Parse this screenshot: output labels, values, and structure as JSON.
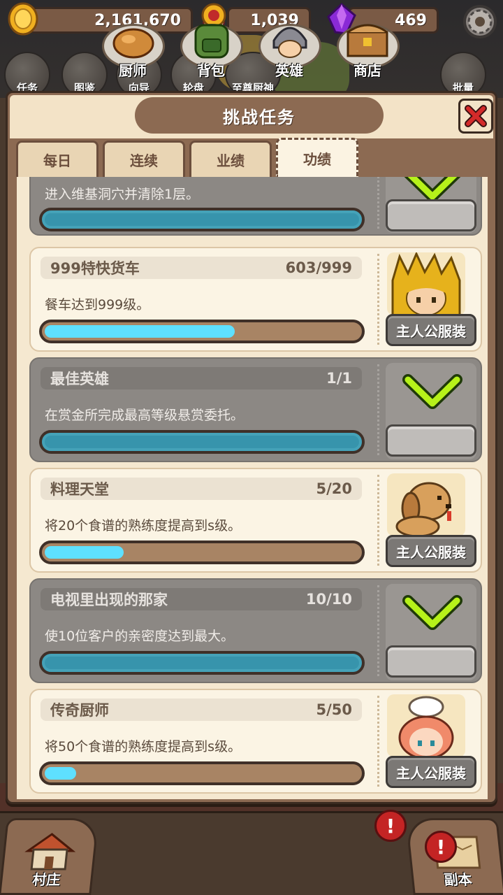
{
  "currency": {
    "gold": "2,161,670",
    "medal": "1,039",
    "gem": "469"
  },
  "shortcuts": [
    "任务",
    "图鉴",
    "向导",
    "轮盘",
    "至尊厨神",
    "",
    "",
    "",
    "批量"
  ],
  "modal": {
    "title": "挑战任务",
    "tabs": [
      "每日",
      "连续",
      "业绩",
      "功绩"
    ],
    "active_tab": "功绩"
  },
  "missions": [
    {
      "title": "",
      "progress": "",
      "desc": "进入维基洞穴并清除1层。",
      "state": "completed",
      "fill": 1.0
    },
    {
      "title": "999特快货车",
      "progress": "603/999",
      "desc": "餐车达到999级。",
      "state": "in_progress",
      "fill": 0.604,
      "reward": "主人公服装"
    },
    {
      "title": "最佳英雄",
      "progress": "1/1",
      "desc": "在赏金所完成最高等级悬赏委托。",
      "state": "completed",
      "fill": 1.0
    },
    {
      "title": "料理天堂",
      "progress": "5/20",
      "desc": "将20个食谱的熟练度提高到s级。",
      "state": "in_progress",
      "fill": 0.25,
      "reward": "主人公服装"
    },
    {
      "title": "电视里出现的那家",
      "progress": "10/10",
      "desc": "使10位客户的亲密度达到最大。",
      "state": "completed",
      "fill": 1.0
    },
    {
      "title": "传奇厨师",
      "progress": "5/50",
      "desc": "将50个食谱的熟练度提高到s级。",
      "state": "in_progress",
      "fill": 0.1,
      "reward": "主人公服装"
    }
  ],
  "bottom_nav": {
    "village": "村庄",
    "chef": "厨师",
    "bag": "背包",
    "hero": "英雄",
    "shop": "商店",
    "dungeon": "副本"
  },
  "alert_glyph": "!",
  "colors": {
    "progress_fill": "#5ee0ff",
    "completed_card": "#8c8884",
    "check": "#b6f21a",
    "close_x": "#d42a2a",
    "alert": "#c42424"
  }
}
